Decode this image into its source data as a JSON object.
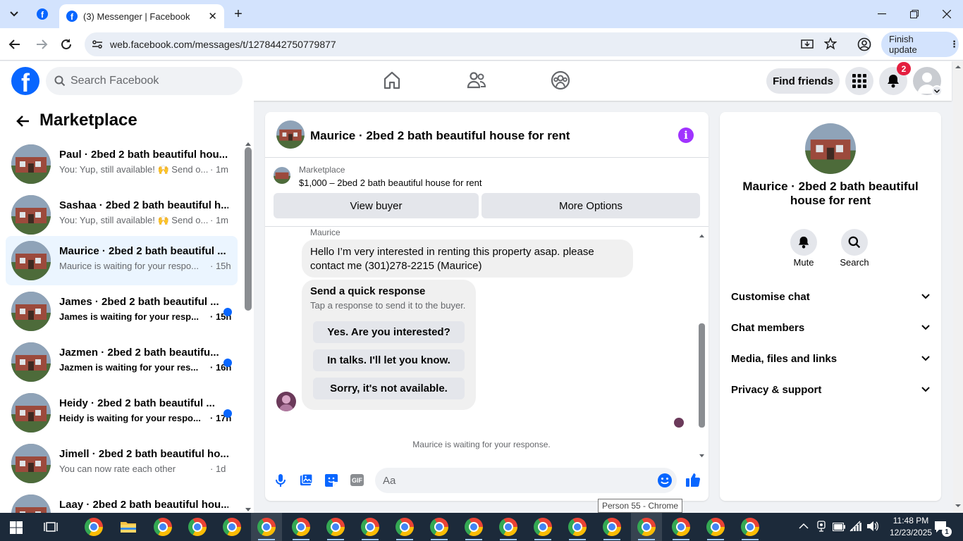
{
  "browser": {
    "tab_title": "(3) Messenger | Facebook",
    "url": "web.facebook.com/messages/t/1278442750779877",
    "finish_update_label": "Finish update"
  },
  "header": {
    "search_placeholder": "Search Facebook",
    "find_friends_label": "Find friends",
    "notification_count": "2"
  },
  "sidebar": {
    "title": "Marketplace",
    "conversations": [
      {
        "name": "Paul · 2bed 2 bath beautiful hou...",
        "snippet": "You: Yup, still available! 🙌 Send o...",
        "time": "· 1m",
        "unread": false,
        "active": false
      },
      {
        "name": "Sashaa · 2bed 2 bath beautiful h...",
        "snippet": "You: Yup, still available! 🙌 Send o...",
        "time": "· 1m",
        "unread": false,
        "active": false
      },
      {
        "name": "Maurice · 2bed 2 bath beautiful ...",
        "snippet": "Maurice is waiting for your respo...",
        "time": "· 15h",
        "unread": false,
        "active": true
      },
      {
        "name": "James · 2bed 2 bath beautiful ...",
        "snippet": "James is waiting for your resp...",
        "time": "· 15h",
        "unread": true,
        "active": false
      },
      {
        "name": "Jazmen · 2bed 2 bath beautifu...",
        "snippet": "Jazmen is waiting for your res...",
        "time": "· 16h",
        "unread": true,
        "active": false
      },
      {
        "name": "Heidy · 2bed 2 bath beautiful ...",
        "snippet": "Heidy is waiting for your respo...",
        "time": "· 17h",
        "unread": true,
        "active": false
      },
      {
        "name": "Jimell · 2bed 2 bath beautiful ho...",
        "snippet": "You can now rate each other",
        "time": "· 1d",
        "unread": false,
        "active": false
      },
      {
        "name": "Laay · 2bed 2 bath beautiful hou...",
        "snippet": "",
        "time": "",
        "unread": false,
        "active": false
      }
    ]
  },
  "chat": {
    "title": "Maurice · 2bed 2 bath beautiful house for rent",
    "listing_label": "Marketplace",
    "listing_price": "$1,000 – 2bed 2 bath beautiful house for rent",
    "view_buyer_label": "View buyer",
    "more_options_label": "More Options",
    "sender_name": "Maurice",
    "message": "Hello I’m very interested in renting this property asap. please contact me (301)278-2215 (Maurice)",
    "quick_response_title": "Send a quick response",
    "quick_response_subtitle": "Tap a response to send it to the buyer.",
    "quick_responses": [
      "Yes. Are you interested?",
      "In talks. I'll let you know.",
      "Sorry, it's not available."
    ],
    "waiting_text": "Maurice is waiting for your response.",
    "composer_placeholder": "Aa"
  },
  "details": {
    "name": "Maurice · 2bed 2 bath beautiful house for rent",
    "mute_label": "Mute",
    "search_label": "Search",
    "sections": [
      "Customise chat",
      "Chat members",
      "Media, files and links",
      "Privacy & support"
    ]
  },
  "tooltip": "Person 55 - Chrome",
  "taskbar": {
    "time": "11:48 PM",
    "date": "12/23/2025",
    "notification_count": "1"
  },
  "colors": {
    "facebook_blue": "#0866ff",
    "messenger_purple": "#a033ff",
    "notification_red": "#e41e3f"
  }
}
